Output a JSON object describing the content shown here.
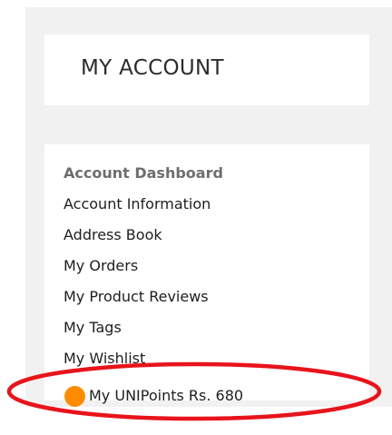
{
  "account": {
    "title": "MY ACCOUNT"
  },
  "nav": {
    "items": [
      {
        "label": "Account Dashboard"
      },
      {
        "label": "Account Information"
      },
      {
        "label": "Address Book"
      },
      {
        "label": "My Orders"
      },
      {
        "label": "My Product Reviews"
      },
      {
        "label": "My Tags"
      },
      {
        "label": "My Wishlist"
      },
      {
        "label": "My UNIPoints Rs. 680"
      }
    ]
  },
  "colors": {
    "points_dot": "#ff8c00",
    "highlight": "#e8141b",
    "panel_bg": "#f1f1f1"
  },
  "icons": {
    "points": "orange-dot-icon"
  }
}
